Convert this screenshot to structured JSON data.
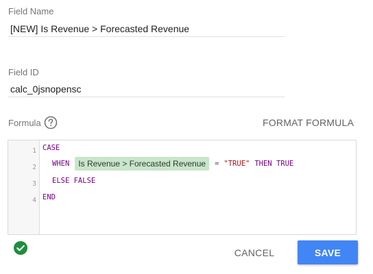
{
  "field_name": {
    "label": "Field Name",
    "value": "[NEW] Is Revenue > Forecasted Revenue"
  },
  "field_id": {
    "label": "Field ID",
    "value": "calc_0jsnopensc"
  },
  "formula": {
    "label": "Formula",
    "help_icon": "help-circle-icon",
    "format_label": "FORMAT FORMULA",
    "line_numbers": [
      "1",
      "2",
      "3",
      "4"
    ],
    "lines": {
      "l1": "CASE",
      "l2_when": "WHEN",
      "l2_chip": "Is Revenue > Forecasted Revenue",
      "l2_eq": "=",
      "l2_str": "\"TRUE\"",
      "l2_then": "THEN TRUE",
      "l3": "ELSE FALSE",
      "l4": "END"
    }
  },
  "status": {
    "icon": "check-circle-icon",
    "color": "#1e8e3e"
  },
  "buttons": {
    "cancel": "CANCEL",
    "save": "SAVE"
  },
  "colors": {
    "accent": "#4285f4",
    "chip": "#c8e6c9",
    "keyword": "#770088",
    "string": "#aa1111"
  }
}
